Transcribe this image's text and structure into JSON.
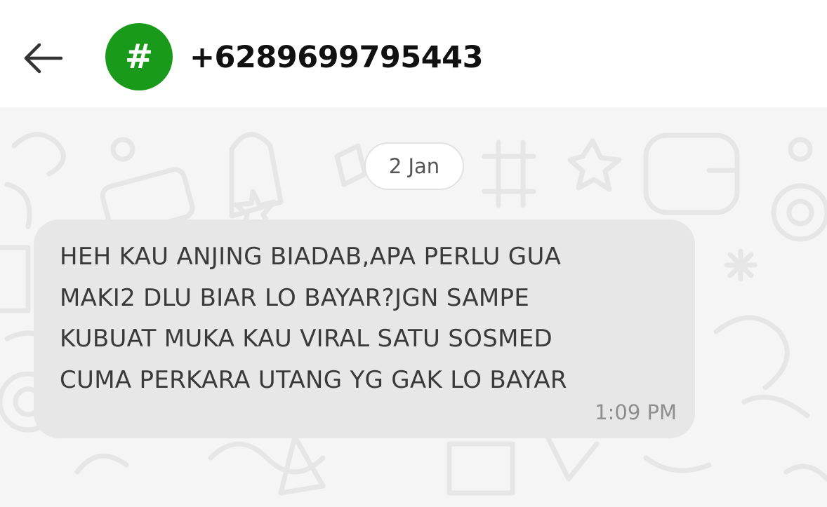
{
  "header": {
    "back_icon": "arrow-left-icon",
    "avatar": {
      "glyph": "#",
      "color": "#1a9a1a"
    },
    "contact_name": "+6289699795443"
  },
  "chat": {
    "date_label": "2 Jan",
    "messages": [
      {
        "direction": "incoming",
        "text": "HEH KAU ANJING BIADAB,APA PERLU GUA\nMAKI2 DLU BIAR LO BAYAR?JGN SAMPE\nKUBUAT MUKA KAU VIRAL SATU SOSMED\nCUMA PERKARA UTANG YG GAK LO BAYAR",
        "time": "1:09 PM"
      }
    ]
  },
  "colors": {
    "header_bg": "#ffffff",
    "chat_bg": "#f5f5f5",
    "bubble_bg": "#e7e7e7",
    "avatar_bg": "#1a9a1a"
  }
}
